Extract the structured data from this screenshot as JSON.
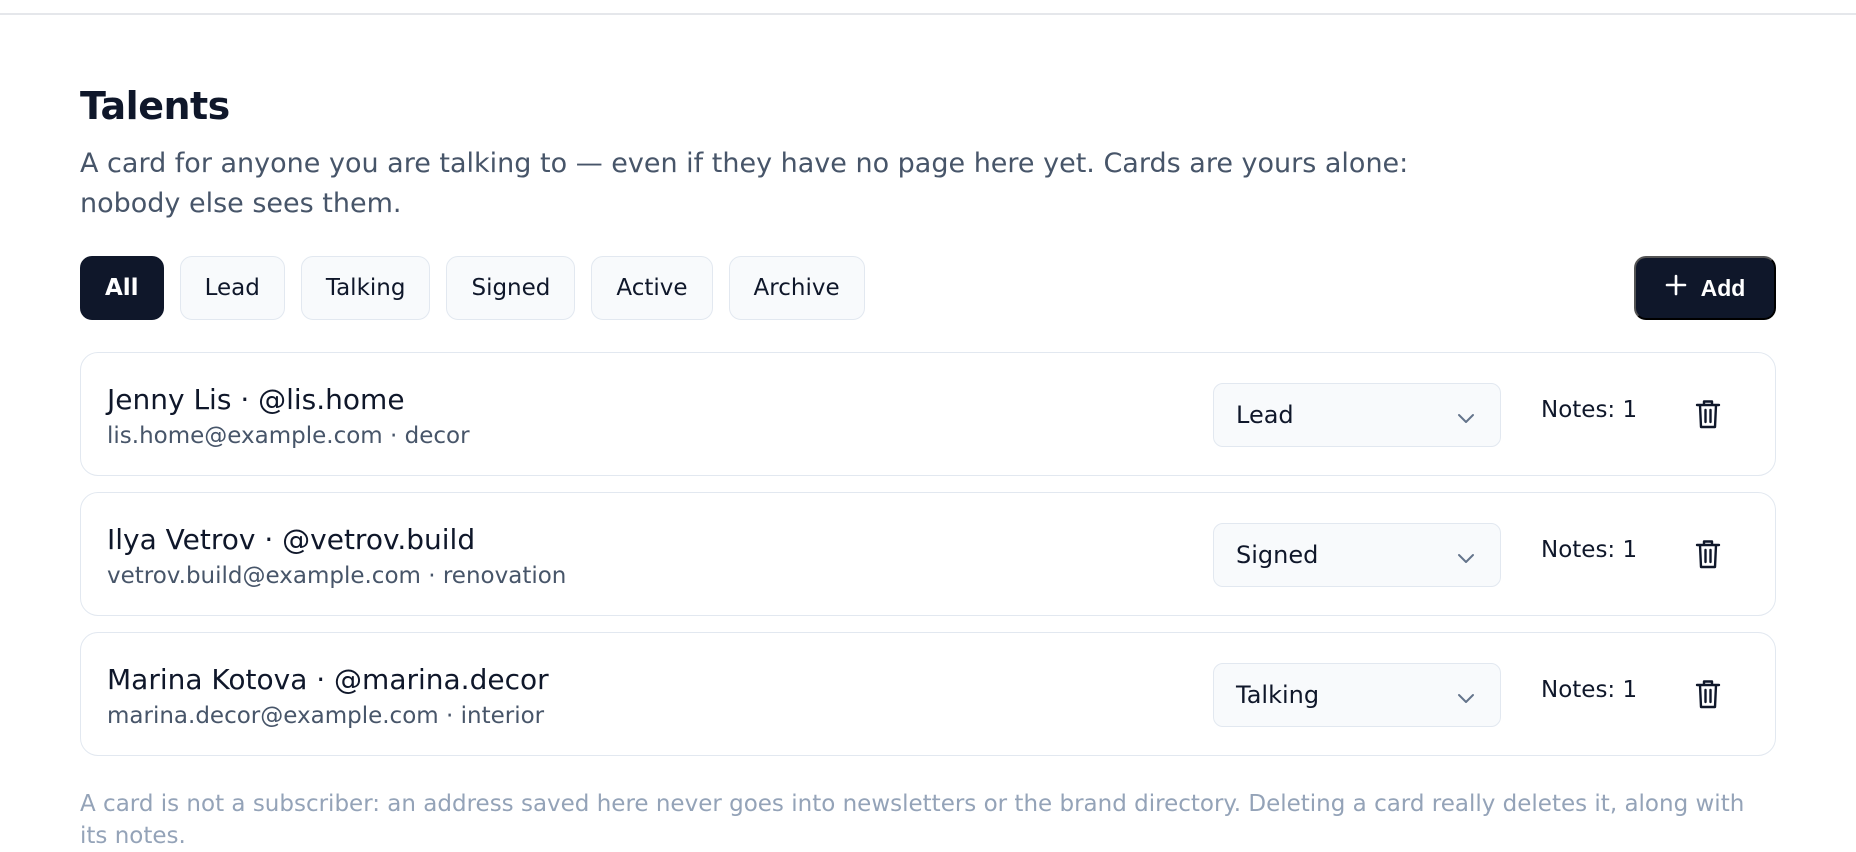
{
  "header": {
    "title": "Talents",
    "subtitle": "A card for anyone you are talking to — even if they have no page here yet. Cards are yours alone: nobody else sees them."
  },
  "filters": {
    "items": [
      "All",
      "Lead",
      "Talking",
      "Signed",
      "Active",
      "Archive"
    ],
    "active": "All"
  },
  "actions": {
    "add_label": "Add",
    "add_icon": "plus-icon"
  },
  "talents": [
    {
      "name_line": "Jenny Lis · @lis.home",
      "meta_line": "lis.home@example.com · decor",
      "status": "Lead",
      "notes": "Notes: 1"
    },
    {
      "name_line": "Ilya Vetrov · @vetrov.build",
      "meta_line": "vetrov.build@example.com · renovation",
      "status": "Signed",
      "notes": "Notes: 1"
    },
    {
      "name_line": "Marina Kotova · @marina.decor",
      "meta_line": "marina.decor@example.com · interior",
      "status": "Talking",
      "notes": "Notes: 1"
    }
  ],
  "footer": {
    "note": "A card is not a subscriber: an address saved here never goes into newsletters or the brand directory. Deleting a card really deletes it, along with its notes."
  },
  "colors": {
    "primary_dark": "#0f172a",
    "muted_text": "#475569",
    "faint_text": "#94a3b8",
    "border": "#e2e8f0",
    "surface": "#f8fafc"
  }
}
